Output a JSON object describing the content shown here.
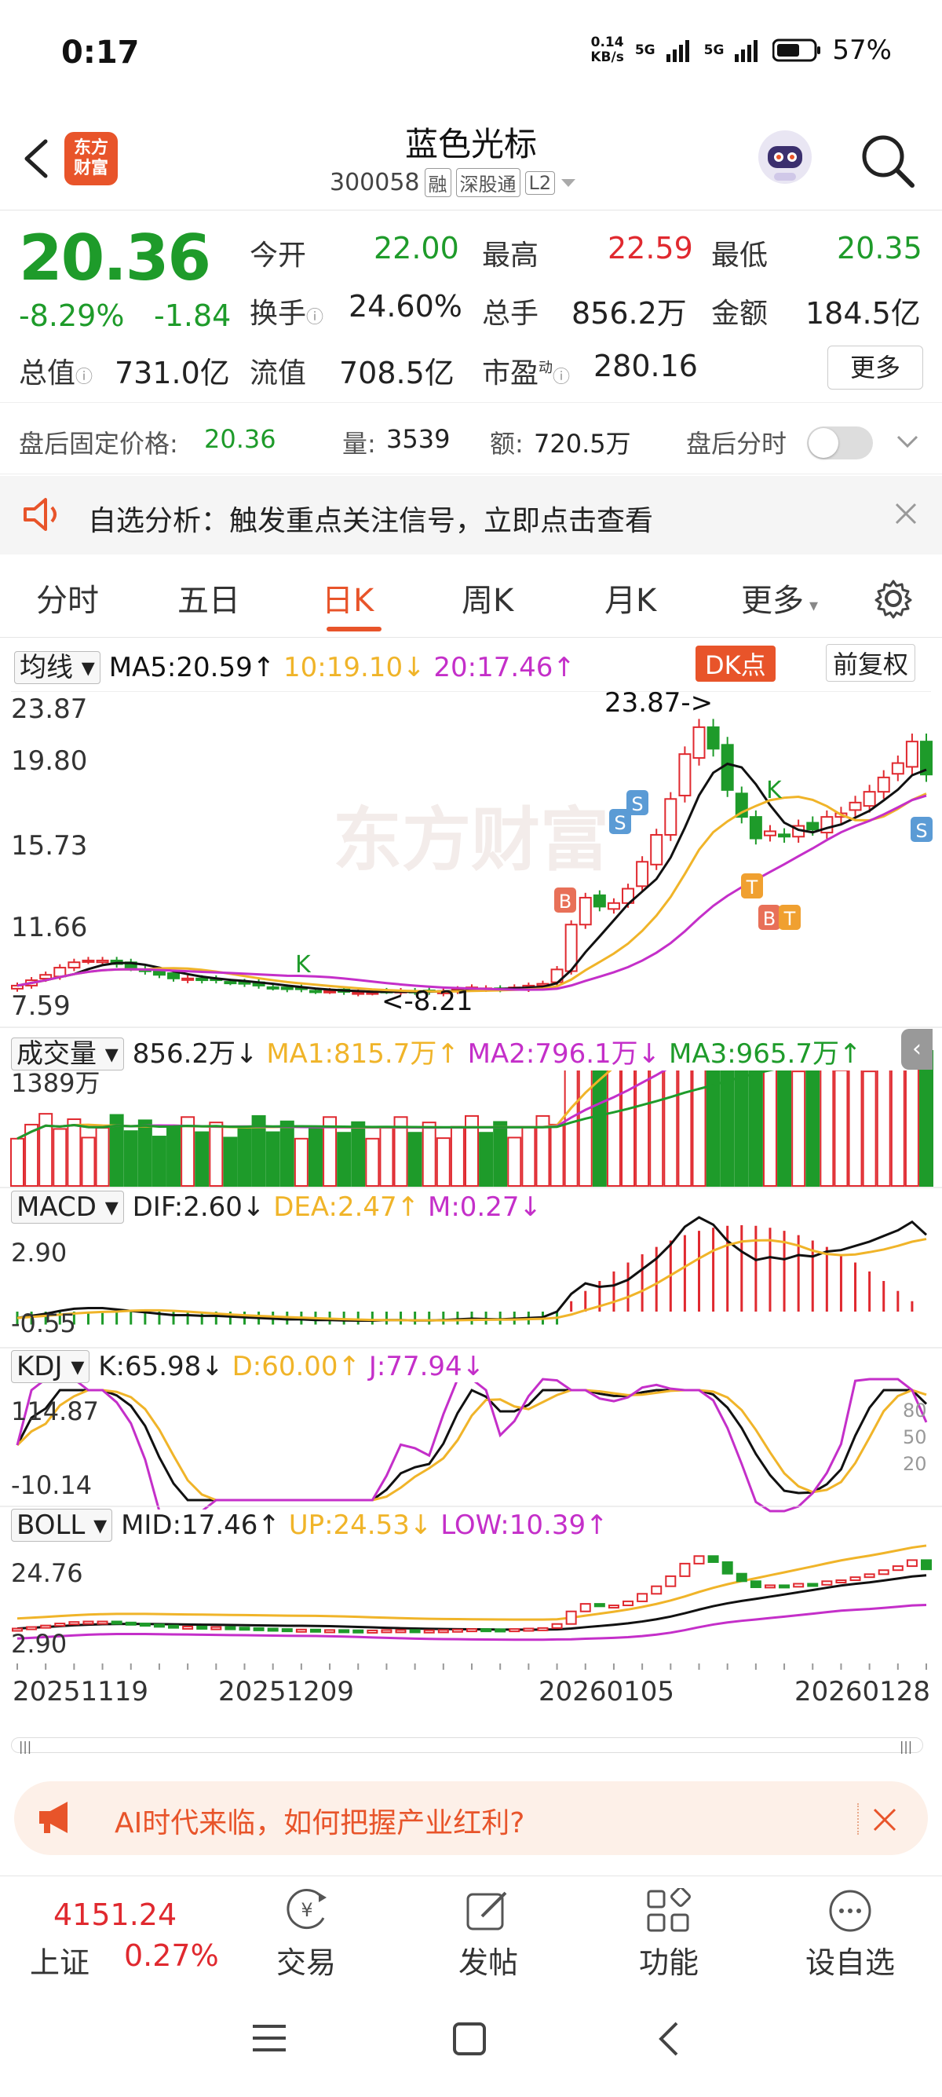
{
  "status": {
    "time": "0:17",
    "speed": "0.14",
    "speed_unit": "KB/s",
    "battery": "57%",
    "net1": "5G",
    "net2": "5G"
  },
  "header": {
    "name": "蓝色光标",
    "code": "300058",
    "tags": [
      "融",
      "深股通",
      "L2"
    ],
    "logo_text": "东方\n财富"
  },
  "quote": {
    "price": "20.36",
    "change_pct": "-8.29%",
    "change": "-1.84",
    "open_label": "今开",
    "open": "22.00",
    "high_label": "最高",
    "high": "22.59",
    "low_label": "最低",
    "low": "20.35",
    "turnover_label": "换手",
    "turnover": "24.60%",
    "volume_label": "总手",
    "volume": "856.2万",
    "amount_label": "金额",
    "amount": "184.5亿",
    "mcap_label": "总值",
    "mcap": "731.0亿",
    "float_label": "流值",
    "float": "708.5亿",
    "pe_label": "市盈",
    "pe_sup": "动",
    "pe": "280.16",
    "more": "更多"
  },
  "after_hours": {
    "price_label": "盘后固定价格:",
    "price": "20.36",
    "vol_label": "量:",
    "vol": "3539",
    "amt_label": "额:",
    "amt": "720.5万",
    "toggle_label": "盘后分时"
  },
  "notice": {
    "text": "自选分析：触发重点关注信号，立即点击查看"
  },
  "tabs": [
    "分时",
    "五日",
    "日K",
    "周K",
    "月K",
    "更多"
  ],
  "kline": {
    "ma_select": "均线",
    "ma5": "MA5:20.59↑",
    "ma10": "10:19.10↓",
    "ma20": "20:17.46↑",
    "dk": "DK点",
    "adjust": "前复权",
    "y_labels": [
      "23.87",
      "19.80",
      "15.73",
      "11.66",
      "7.59"
    ],
    "max_note": "23.87->",
    "min_note": "<-8.21",
    "watermark": "东方财富",
    "signals": {
      "b": "B",
      "s": "S",
      "k": "K",
      "t": "T",
      "bt_b": "B",
      "bt_t": "T"
    }
  },
  "volume": {
    "select": "成交量",
    "val": "856.2万↓",
    "ma1": "MA1:815.7万↑",
    "ma2": "MA2:796.1万↓",
    "ma3": "MA3:965.7万↑",
    "y_label": "1389万"
  },
  "macd": {
    "select": "MACD",
    "dif": "DIF:2.60↓",
    "dea": "DEA:2.47↑",
    "m": "M:0.27↓",
    "y_top": "2.90",
    "y_bottom": "-0.55"
  },
  "kdj": {
    "select": "KDJ",
    "k": "K:65.98↓",
    "d": "D:60.00↑",
    "j": "J:77.94↓",
    "y_top": "114.87",
    "y_bottom": "-10.14",
    "r80": "80",
    "r50": "50",
    "r20": "20"
  },
  "boll": {
    "select": "BOLL",
    "mid": "MID:17.46↑",
    "up": "UP:24.53↓",
    "low": "LOW:10.39↑",
    "y_top": "24.76",
    "y_bottom": "2.90"
  },
  "dates": [
    "20251119",
    "20251209",
    "20260105",
    "20260128"
  ],
  "ad": {
    "text": "AI时代来临，如何把握产业红利?"
  },
  "bottom": {
    "index_val": "4151.24",
    "index_name": "上证",
    "index_pct": "0.27%",
    "items": [
      "交易",
      "发帖",
      "功能",
      "设自选"
    ]
  },
  "colors": {
    "up": "#e0292f",
    "down": "#1e9b2a",
    "accent": "#e8542a",
    "ma10": "#f0b429",
    "ma20": "#c42fc9"
  }
}
